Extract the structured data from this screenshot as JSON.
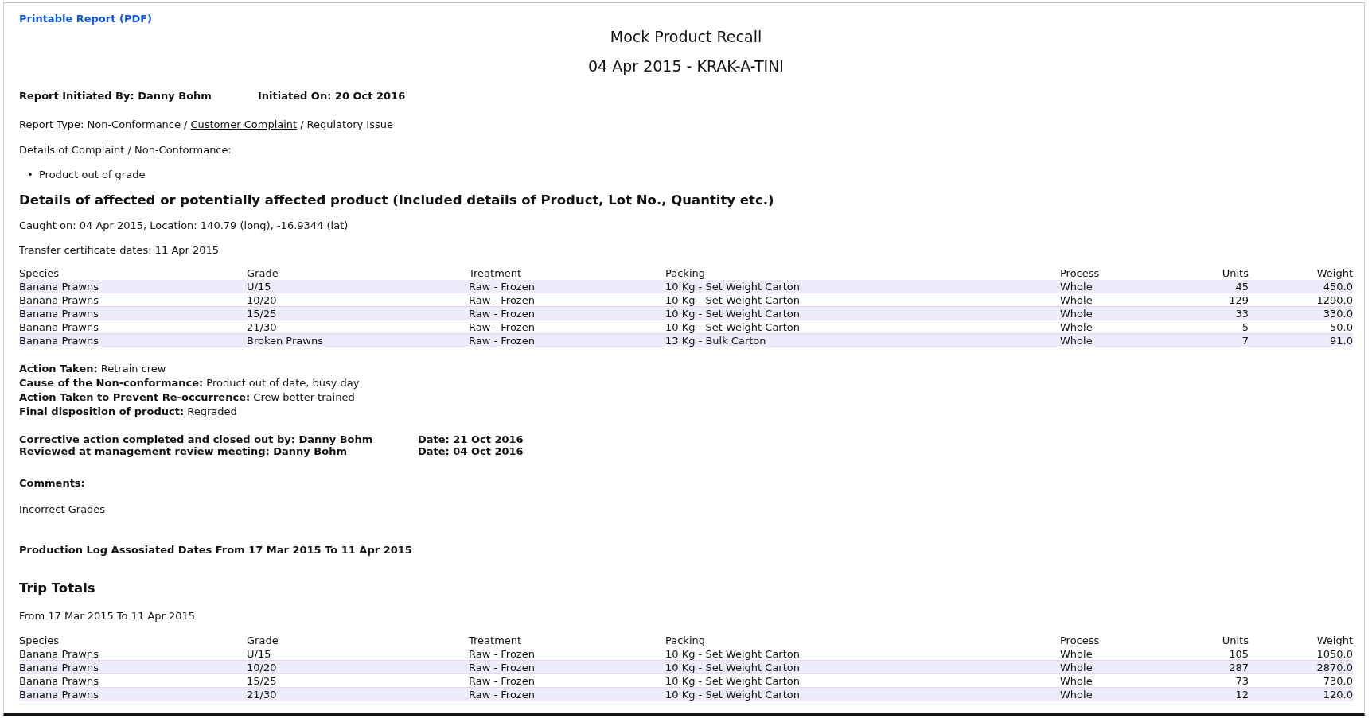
{
  "pdf_link": "Printable Report (PDF)",
  "title": "Mock Product Recall",
  "subtitle": "04 Apr 2015 - KRAK-A-TINI",
  "initiated_by": "Report Initiated By: Danny Bohm",
  "initiated_on": "Initiated On: 20 Oct 2016",
  "report_type_label": "Report Type:",
  "type_separator": "/",
  "bullet": "•",
  "report_types": [
    {
      "label": "Non-Conformance",
      "selected": false
    },
    {
      "label": "Customer Complaint",
      "selected": true
    },
    {
      "label": "Regulatory Issue",
      "selected": false
    }
  ],
  "details_label": "Details of Complaint / Non-Conformance:",
  "details_items": [
    "Product out of grade"
  ],
  "affected_heading": "Details of affected or potentially affected product (Included details of Product, Lot No., Quantity etc.)",
  "caught_on": "Caught on: 04 Apr 2015, Location: 140.79 (long), -16.9344 (lat)",
  "transfer_dates": "Transfer certificate dates: 11 Apr 2015",
  "affected_table": {
    "columns": [
      "Species",
      "Grade",
      "Treatment",
      "Packing",
      "Process",
      "Units",
      "Weight"
    ],
    "rows": [
      {
        "shaded": true,
        "cells": [
          "Banana Prawns",
          "U/15",
          "Raw - Frozen",
          "10 Kg - Set Weight Carton",
          "Whole",
          "45",
          "450.0"
        ]
      },
      {
        "shaded": false,
        "cells": [
          "Banana Prawns",
          "10/20",
          "Raw - Frozen",
          "10 Kg - Set Weight Carton",
          "Whole",
          "129",
          "1290.0"
        ]
      },
      {
        "shaded": true,
        "cells": [
          "Banana Prawns",
          "15/25",
          "Raw - Frozen",
          "10 Kg - Set Weight Carton",
          "Whole",
          "33",
          "330.0"
        ]
      },
      {
        "shaded": false,
        "cells": [
          "Banana Prawns",
          "21/30",
          "Raw - Frozen",
          "10 Kg - Set Weight Carton",
          "Whole",
          "5",
          "50.0"
        ]
      },
      {
        "shaded": true,
        "cells": [
          "Banana Prawns",
          "Broken Prawns",
          "Raw - Frozen",
          "13 Kg - Bulk Carton",
          "Whole",
          "7",
          "91.0"
        ]
      }
    ]
  },
  "actions": [
    "**Action Taken:** Retrain crew",
    "**Cause of the Non-conformance:** Product out of date, busy day",
    "**Action Taken to Prevent Re-occurrence:** Crew better trained",
    "**Final disposition of product:** Regraded"
  ],
  "signoffs": [
    {
      "by": "Corrective action completed and closed out by: Danny Bohm",
      "date": "Date: 21 Oct 2016"
    },
    {
      "by": "Reviewed at management review meeting: Danny Bohm",
      "date": "Date: 04 Oct 2016"
    }
  ],
  "comments_label": "Comments:",
  "comments": "Incorrect Grades",
  "production_log": "Production Log Assosiated Dates From 17 Mar 2015 To 11 Apr 2015",
  "trip_heading": "Trip Totals",
  "trip_range": "From 17 Mar 2015 To 11 Apr 2015",
  "trip_table": {
    "columns": [
      "Species",
      "Grade",
      "Treatment",
      "Packing",
      "Process",
      "Units",
      "Weight"
    ],
    "rows": [
      {
        "shaded": false,
        "cells": [
          "Banana Prawns",
          "U/15",
          "Raw - Frozen",
          "10 Kg - Set Weight Carton",
          "Whole",
          "105",
          "1050.0"
        ]
      },
      {
        "shaded": true,
        "cells": [
          "Banana Prawns",
          "10/20",
          "Raw - Frozen",
          "10 Kg - Set Weight Carton",
          "Whole",
          "287",
          "2870.0"
        ]
      },
      {
        "shaded": false,
        "cells": [
          "Banana Prawns",
          "15/25",
          "Raw - Frozen",
          "10 Kg - Set Weight Carton",
          "Whole",
          "73",
          "730.0"
        ]
      },
      {
        "shaded": true,
        "cells": [
          "Banana Prawns",
          "21/30",
          "Raw - Frozen",
          "10 Kg - Set Weight Carton",
          "Whole",
          "12",
          "120.0"
        ]
      }
    ]
  }
}
